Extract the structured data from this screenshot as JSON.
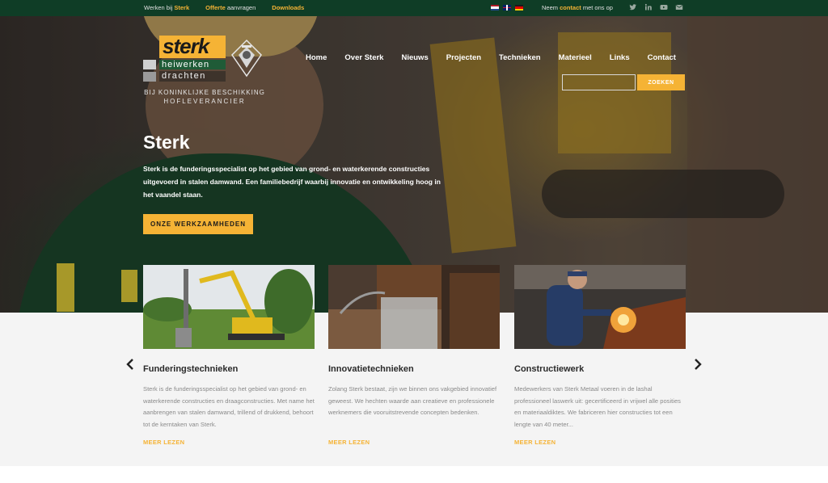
{
  "topbar": {
    "werken_prefix": "Werken bij ",
    "werken_brand": "Sterk",
    "offerte_bold": "Offerte",
    "offerte_rest": " aanvragen",
    "downloads": "Downloads",
    "contact_prefix": "Neem ",
    "contact_link": "contact",
    "contact_suffix": " met ons op",
    "languages": [
      "nl",
      "en",
      "de"
    ],
    "social_icons": [
      "twitter-icon",
      "linkedin-icon",
      "youtube-icon",
      "mail-icon"
    ]
  },
  "logo": {
    "brand": "sterk",
    "line2": "heiwerken",
    "line3": "drachten",
    "royal_line1": "BIJ KONINKLIJKE BESCHIKKING",
    "royal_line2": "HOFLEVERANCIER"
  },
  "nav": {
    "items": [
      "Home",
      "Over Sterk",
      "Nieuws",
      "Projecten",
      "Technieken",
      "Materieel",
      "Links",
      "Contact"
    ]
  },
  "search": {
    "value": "",
    "button": "ZOEKEN"
  },
  "hero": {
    "title": "Sterk",
    "text": "Sterk is de funderingsspecialist op het gebied van grond- en waterkerende constructies uitgevoerd in stalen damwand. Een familiebedrijf waarbij innovatie en ontwikkeling hoog in het vaandel staan.",
    "button": "ONZE WERKZAAMHEDEN"
  },
  "cards": [
    {
      "title": "Funderingstechnieken",
      "text": "Sterk is de funderingsspecialist op het gebied van grond- en waterkerende constructies en draagconstructies. Met name het aanbrengen van stalen damwand, trillend of drukkend, behoort tot de kerntaken van Sterk.",
      "more": "MEER LEZEN"
    },
    {
      "title": "Innovatietechnieken",
      "text": "Zolang Sterk bestaat, zijn we binnen ons vakgebied innovatief geweest. We hechten waarde aan creatieve en professionele werknemers die vooruitstrevende concepten bedenken.",
      "more": "MEER LEZEN"
    },
    {
      "title": "Constructiewerk",
      "text": "Medewerkers van Sterk Metaal voeren in de lashal professioneel laswerk uit: gecertificeerd in vrijwel alle posities en materiaaldiktes. We fabriceren hier constructies tot een lengte van 40 meter...",
      "more": "MEER LEZEN"
    }
  ],
  "carousel": {
    "prev_icon": "chevron-left-icon",
    "next_icon": "chevron-right-icon"
  },
  "colors": {
    "topbar_bg": "#0f3d26",
    "accent": "#f5b335",
    "brand_green": "#1f5b37"
  }
}
